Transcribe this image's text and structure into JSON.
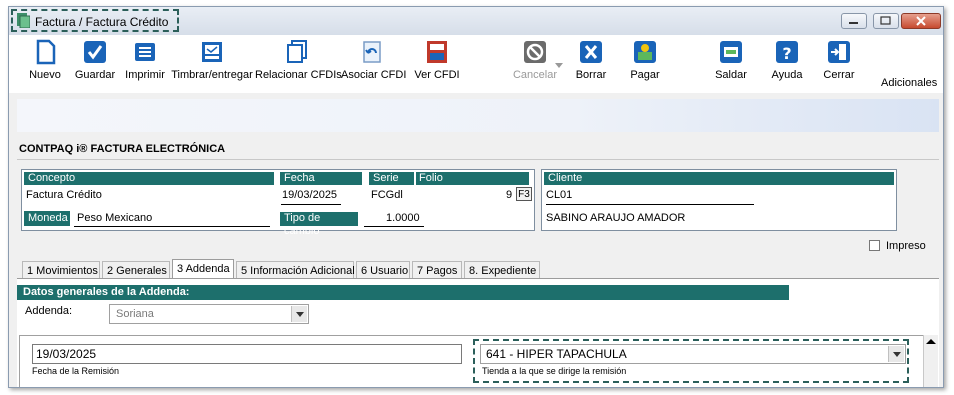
{
  "window": {
    "title": "Factura / Factura Crédito"
  },
  "toolbar": {
    "items": [
      {
        "label": "Nuevo",
        "icon": "new-document-icon"
      },
      {
        "label": "Guardar",
        "icon": "checkmark-icon"
      },
      {
        "label": "Imprimir",
        "icon": "printer-icon"
      },
      {
        "label": "Timbrar/entregar",
        "icon": "stamp-icon"
      },
      {
        "label": "Relacionar CFDIs",
        "icon": "stacked-documents-icon"
      },
      {
        "label": "Asociar CFDI",
        "icon": "link-document-icon"
      },
      {
        "label": "Ver CFDI",
        "icon": "view-cfdi-icon"
      },
      {
        "label": "Cancelar",
        "icon": "cancel-icon",
        "disabled": true
      },
      {
        "label": "Borrar",
        "icon": "delete-x-icon"
      },
      {
        "label": "Pagar",
        "icon": "pay-icon"
      },
      {
        "label": "Saldar",
        "icon": "settle-icon"
      },
      {
        "label": "Ayuda",
        "icon": "help-icon"
      },
      {
        "label": "Cerrar",
        "icon": "exit-door-icon"
      }
    ],
    "adicionales": "Adicionales"
  },
  "header": {
    "company": "CONTPAQ i® FACTURA ELECTRÓNICA"
  },
  "document": {
    "concepto_label": "Concepto",
    "concepto_value": "Factura Crédito",
    "fecha_label": "Fecha",
    "fecha_value": "19/03/2025",
    "serie_label": "Serie",
    "folio_label": "Folio",
    "serie_value": "FCGdl",
    "folio_value": "9",
    "f3_label": "F3",
    "cliente_label": "Cliente",
    "cliente_code": "CL01",
    "cliente_name": "SABINO ARAUJO AMADOR",
    "moneda_label": "Moneda",
    "moneda_value": "Peso Mexicano",
    "tipo_cambio_label": "Tipo de cambio",
    "tipo_cambio_value": "1.0000",
    "impreso_label": "Impreso"
  },
  "tabs": [
    {
      "label": "1 Movimientos"
    },
    {
      "label": "2 Generales"
    },
    {
      "label": "3 Addenda",
      "active": true
    },
    {
      "label": "5 Información Adicional"
    },
    {
      "label": "6 Usuario"
    },
    {
      "label": "7 Pagos"
    },
    {
      "label": "8. Expediente"
    }
  ],
  "addenda": {
    "section_title": "Datos generales de la Addenda:",
    "addenda_label": "Addenda:",
    "addenda_value": "Soriana",
    "fecha_remision_value": "19/03/2025",
    "fecha_remision_label": "Fecha de la Remisión",
    "tienda_value": "641 - HIPER TAPACHULA",
    "tienda_label": "Tienda a la que se dirige la remisión"
  },
  "colors": {
    "caption_bg": "#1d6f6c",
    "highlight_border": "#2b5f5a",
    "accent_blue": "#1a64b8"
  }
}
